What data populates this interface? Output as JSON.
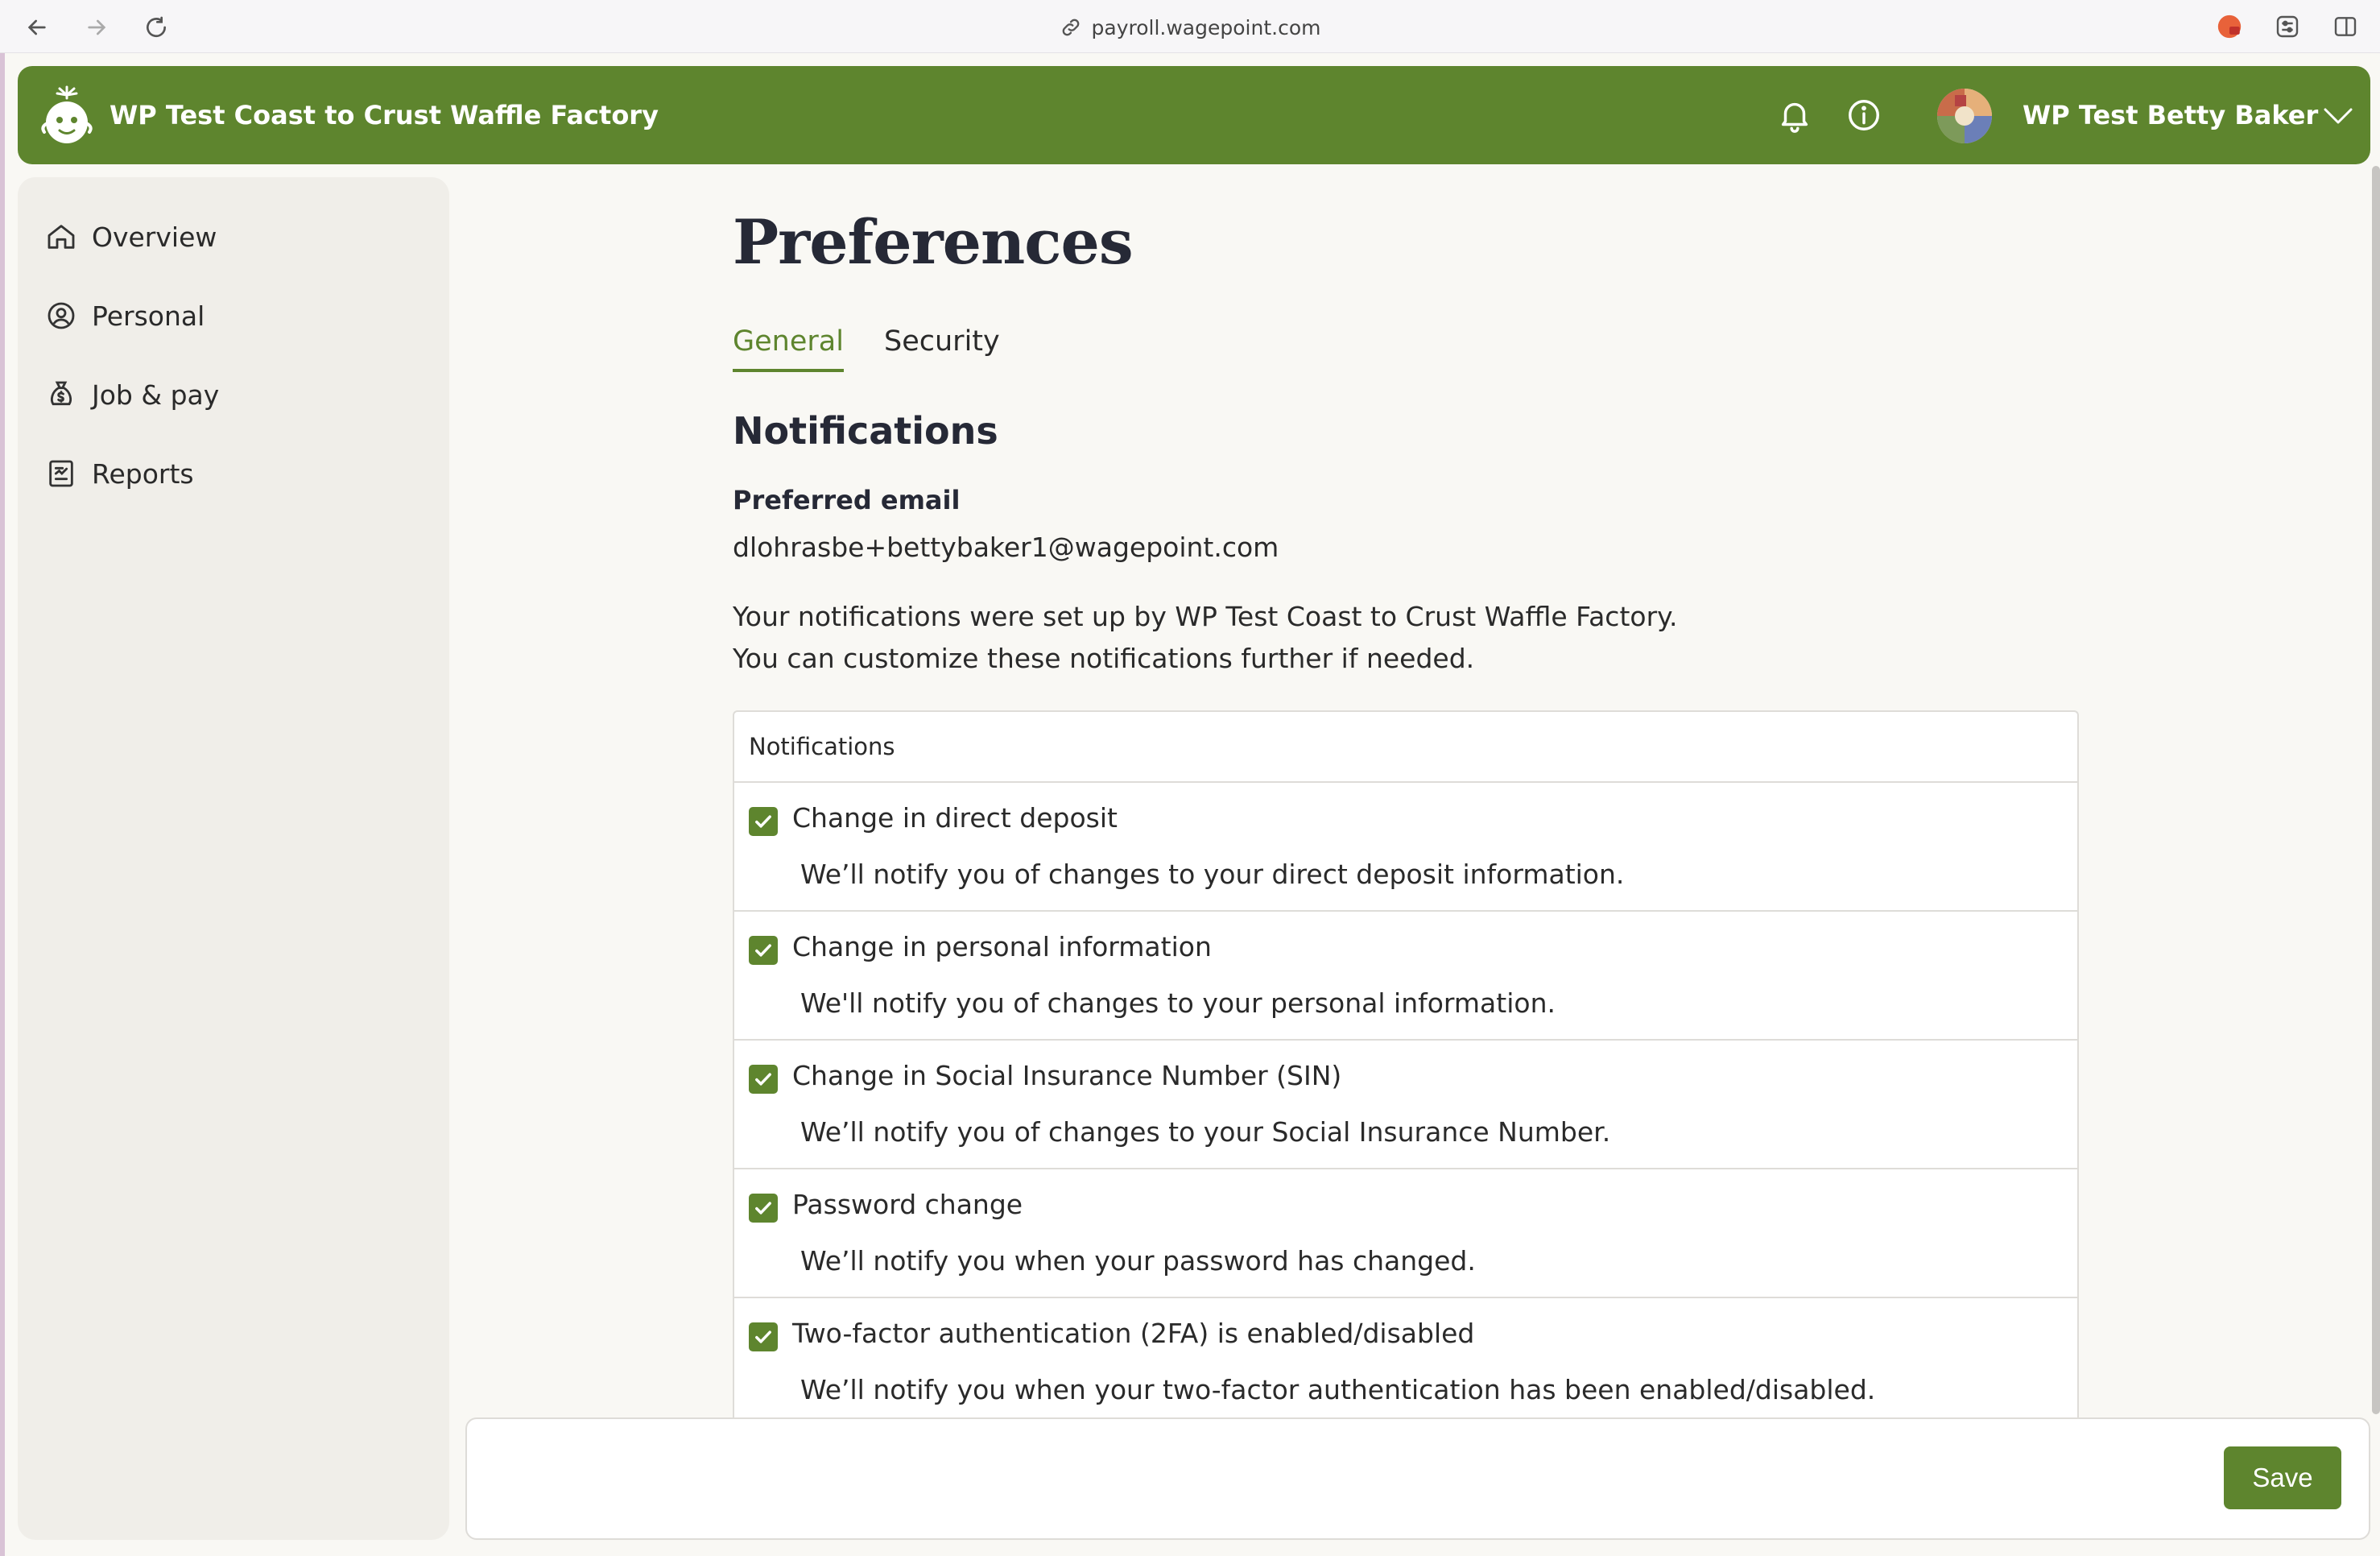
{
  "browser": {
    "url": "payroll.wagepoint.com"
  },
  "header": {
    "company_name": "WP Test Coast to Crust Waffle Factory",
    "user_name": "WP Test Betty Baker"
  },
  "sidebar": {
    "items": [
      {
        "label": "Overview",
        "icon": "home-icon"
      },
      {
        "label": "Personal",
        "icon": "user-circle-icon"
      },
      {
        "label": "Job & pay",
        "icon": "money-bag-icon"
      },
      {
        "label": "Reports",
        "icon": "report-icon"
      }
    ]
  },
  "page": {
    "title": "Preferences",
    "tabs": [
      "General",
      "Security"
    ],
    "active_tab": "General",
    "section_title": "Notifications",
    "preferred_email_label": "Preferred email",
    "preferred_email": "dlohrasbe+bettybaker1@wagepoint.com",
    "intro_line1": "Your notifications were set up by WP Test Coast to Crust Waffle Factory.",
    "intro_line2": "You can customize these notifications further if needed."
  },
  "notifications": {
    "header": "Notifications",
    "items": [
      {
        "title": "Change in direct deposit",
        "description": "We’ll notify you of changes to your direct deposit information.",
        "checked": true
      },
      {
        "title": "Change in personal information",
        "description": "We'll notify you of changes to your personal information.",
        "checked": true
      },
      {
        "title": "Change in Social Insurance Number (SIN)",
        "description": "We’ll notify you of changes to your Social Insurance Number.",
        "checked": true
      },
      {
        "title": "Password change",
        "description": "We’ll notify you when your password has changed.",
        "checked": true
      },
      {
        "title": "Two-factor authentication (2FA) is enabled/disabled",
        "description": "We’ll notify you when your two-factor authentication has been enabled/disabled.",
        "checked": true
      }
    ]
  },
  "footer": {
    "save_label": "Save"
  },
  "colors": {
    "brand_green": "#5e852e",
    "background": "#f9f8f4",
    "sidebar_bg": "#f0eee9"
  }
}
